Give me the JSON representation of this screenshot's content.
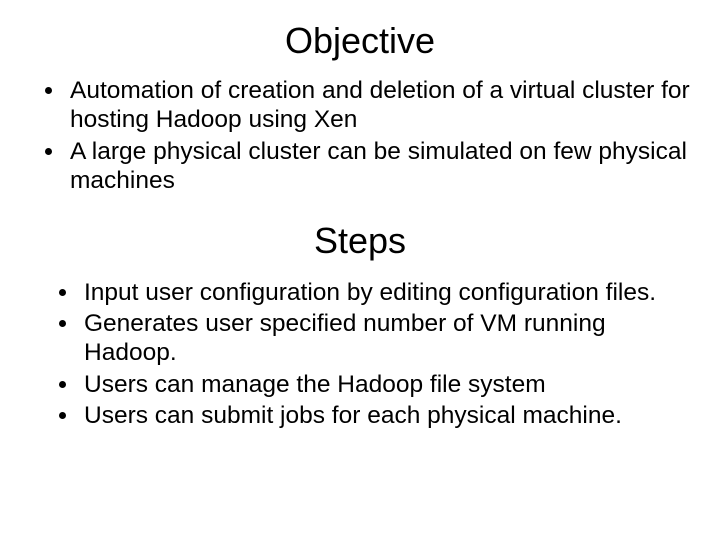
{
  "section1": {
    "heading": "Objective",
    "bullets": [
      "Automation of creation and deletion of a virtual cluster for hosting Hadoop using Xen",
      "A large physical cluster can be simulated on few physical machines"
    ]
  },
  "section2": {
    "heading": "Steps",
    "bullets": [
      "Input user configuration by editing configuration files.",
      "Generates user specified number of VM running Hadoop.",
      "Users can manage the Hadoop file system",
      "Users can submit jobs for each physical machine."
    ]
  }
}
